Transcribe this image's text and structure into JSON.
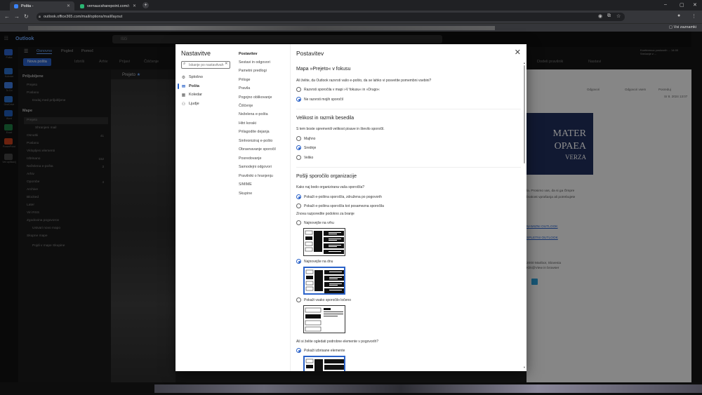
{
  "browser": {
    "tabs": [
      {
        "label": "Pošta -",
        "active": true
      },
      {
        "label": "vernaucsharepoint.com/sites/IT/...",
        "active": false
      }
    ],
    "url": "outlook.office365.com/mail/options/mail/layout",
    "other_bookmarks": "Vsi zaznamki"
  },
  "outlook": {
    "app_name": "Outlook",
    "search_placeholder": "Išči",
    "ribbon_tabs": [
      "Osnovno",
      "Pogled",
      "Pomoč"
    ],
    "new_mail": "Nova pošta",
    "toolbar": [
      "Izbriši",
      "Arhiv",
      "Prijavi",
      "Čiščenje"
    ],
    "toolbar_right": [
      "Dodeli pravilnik",
      "Nastavi"
    ],
    "rail": [
      "Pošta",
      "Koledar",
      "To Do",
      "OneDrive",
      "Word",
      "Excel",
      "PowerPoint",
      "Več aplikacij"
    ],
    "favorites_header": "Priljubljene",
    "favorites": [
      "Prejeto",
      "Poslano",
      "Dodaj med priljubljene"
    ],
    "folders_header": "Mape",
    "folders": [
      {
        "name": "Prejeto",
        "count": ""
      },
      {
        "name": "Shranjeni mail",
        "count": ""
      },
      {
        "name": "Osnutki",
        "count": "41"
      },
      {
        "name": "Poslano",
        "count": ""
      },
      {
        "name": "Vklopljeni elementi",
        "count": ""
      },
      {
        "name": "Izbrisano",
        "count": "152"
      },
      {
        "name": "Neželena e-pošta",
        "count": "3"
      },
      {
        "name": "Arhiv",
        "count": ""
      },
      {
        "name": "Opombe",
        "count": "4"
      },
      {
        "name": "Archive",
        "count": ""
      },
      {
        "name": "Blocked",
        "count": ""
      },
      {
        "name": "Later",
        "count": ""
      },
      {
        "name": "Viri RSS",
        "count": ""
      },
      {
        "name": "Zgodovina pogovorov",
        "count": ""
      },
      {
        "name": "Ustvari novo mapo",
        "count": ""
      },
      {
        "name": "Skupne mape",
        "count": ""
      },
      {
        "name": "Pojdi v mape Skupine",
        "count": ""
      }
    ],
    "list_header": "Prejeto",
    "reading": {
      "toolbar": [
        "Odgovori",
        "Odgovori vsem",
        "Posreduj"
      ],
      "date": "Sr 8. 2024 13:07",
      "banner_line1": "MATER",
      "banner_line2": "OPAEA",
      "banner_line3": "VERZA",
      "text_lines": [
        "la. Prosimo vas, da si ga Ömpre",
        "brakost vprašanja ali potrebujete"
      ],
      "links": [
        "NAMIZNI OUTLOOK",
        "SPLETNI OUTLOOK"
      ],
      "footer": [
        "2000 Maribor, Slovenia",
        "Klik@View in browser"
      ]
    },
    "notification": "Konferenca poslovnih ... 14:00 Srečanje z ..."
  },
  "dialog": {
    "title": "Nastavitve",
    "search_placeholder": "Iskanje po nastavitvah",
    "categories": [
      {
        "label": "Splošno",
        "icon": "gear-icon"
      },
      {
        "label": "Pošta",
        "icon": "mail-icon"
      },
      {
        "label": "Koledar",
        "icon": "calendar-icon"
      },
      {
        "label": "Ljudje",
        "icon": "people-icon"
      }
    ],
    "subcategories": [
      "Postavitev",
      "Sestavi in odgovori",
      "Pametni predlogi",
      "Priloge",
      "Pravila",
      "Pogojno oblikovanje",
      "Čiščenje",
      "Neželena e-pošta",
      "Hitri koraki",
      "Prilagodite dejanja",
      "Sinhroniziraj e-pošto",
      "Obravnavanje sporočil",
      "Posredovanje",
      "Samodejni odgovori",
      "Pravilniki o hranjenju",
      "S/MIME",
      "Skupine"
    ],
    "pane_title": "Postavitev",
    "focused": {
      "heading": "Mapa »Prejeto« v fokusu",
      "question": "Ali želite, da Outlook razvrsti vašo e-pošto, da se lahko vi posvetite pomembni vsebini?",
      "options": [
        "Razvrsti sporočila v mapi »V fokusu« in »Drugo«",
        "Ne razvrsti mojih sporočil"
      ],
      "selected": 1
    },
    "density": {
      "heading": "Velikost in razmik besedila",
      "question": "S tem boste spremenili velikost pisave in število sporočil.",
      "options": [
        "Majhno",
        "Srednje",
        "Veliko"
      ],
      "selected": 1
    },
    "organize": {
      "heading": "Pošlji sporočilo organizacije",
      "question": "Kako naj bodo organizirana vaša sporočila?",
      "options": [
        "Pokaži e-poštna sporočila, združena po pogovorih",
        "Pokaži e-poštna sporočila kot posamezna sporočila"
      ],
      "selected": 0,
      "arrange_label": "Znova razporedite podokno za branje",
      "arrange_options": [
        "Najnovejše na vrhu",
        "Najnovejše na dnu",
        "Pokaži vsako sporočilo ločeno"
      ],
      "arrange_selected": 1
    },
    "details": {
      "question": "Ali si želite ogledati podrobne elemente v pogovorih?",
      "options": [
        "Pokaži izbrisane elemente"
      ],
      "selected": 0
    }
  }
}
